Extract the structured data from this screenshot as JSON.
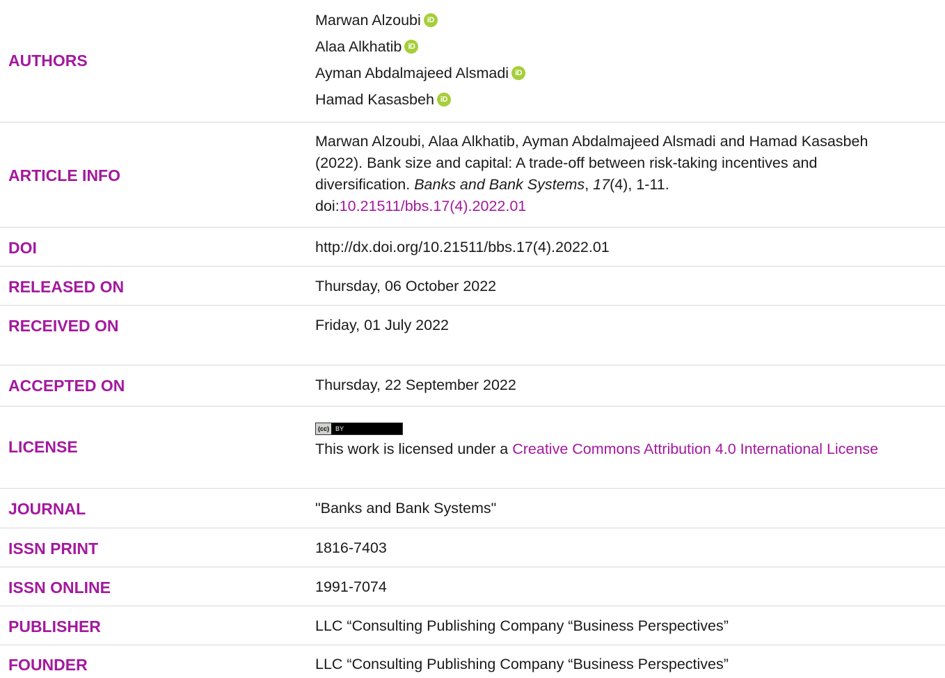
{
  "rows": {
    "authors": {
      "label": "AUTHORS",
      "names": [
        "Marwan Alzoubi",
        "Alaa Alkhatib",
        "Ayman Abdalmajeed Alsmadi",
        "Hamad Kasasbeh"
      ],
      "orcid_icon_text": "iD"
    },
    "article_info": {
      "label": "ARTICLE INFO",
      "citation_prefix": "Marwan Alzoubi, Alaa Alkhatib, Ayman Abdalmajeed Alsmadi and Hamad Kasasbeh (2022). Bank size and capital: A trade-off between risk-taking incentives and diversification. ",
      "journal_italic": "Banks and Bank Systems",
      "sep1": ", ",
      "volume_italic": "17",
      "issue_pages": "(4), 1-11.",
      "doi_prefix": "doi:",
      "doi_link": "10.21511/bbs.17(4).2022.01"
    },
    "doi": {
      "label": "DOI",
      "value": "http://dx.doi.org/10.21511/bbs.17(4).2022.01"
    },
    "released": {
      "label": "RELEASED ON",
      "value": "Thursday, 06 October 2022"
    },
    "received": {
      "label": "RECEIVED ON",
      "value": "Friday, 01 July 2022"
    },
    "accepted": {
      "label": "ACCEPTED ON",
      "value": "Thursday, 22 September 2022"
    },
    "license": {
      "label": "LICENSE",
      "badge_cc": "(cc)",
      "badge_by": "BY",
      "text_prefix": "This work is licensed under a ",
      "link_text": "Creative Commons Attribution 4.0 International License"
    },
    "journal": {
      "label": "JOURNAL",
      "value": "\"Banks and Bank Systems\""
    },
    "issn_print": {
      "label": "ISSN PRINT",
      "value": "1816-7403"
    },
    "issn_online": {
      "label": "ISSN ONLINE",
      "value": "1991-7074"
    },
    "publisher": {
      "label": "PUBLISHER",
      "value": "LLC “Consulting Publishing Company “Business Perspectives”"
    },
    "founder": {
      "label": "FOUNDER",
      "value": "LLC “Consulting Publishing Company “Business Perspectives”"
    }
  },
  "colors": {
    "label": "#a3199e",
    "link": "#a3199e",
    "orcid": "#a6ce39"
  }
}
